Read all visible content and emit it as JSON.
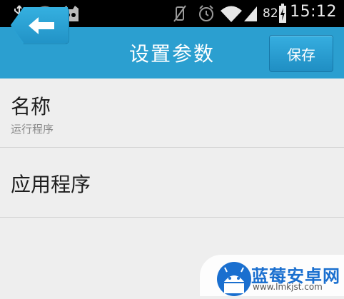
{
  "status_bar": {
    "battery_level": "82",
    "time": "15:12",
    "icons": [
      "usb-icon",
      "wifi-unknown-icon",
      "cyanogen-icon",
      "vibrate-icon",
      "alarm-icon",
      "wifi-icon",
      "signal-icon",
      "battery-charging-icon"
    ]
  },
  "action_bar": {
    "title": "设置参数",
    "save_label": "保存",
    "back_icon": "back-arrow-icon",
    "color": "#2b9fd0"
  },
  "settings": [
    {
      "title": "名称",
      "subtitle": "运行程序"
    },
    {
      "title": "应用程序"
    }
  ],
  "watermark": {
    "title": "蓝莓安卓网",
    "url": "www.lmkjst.com"
  }
}
